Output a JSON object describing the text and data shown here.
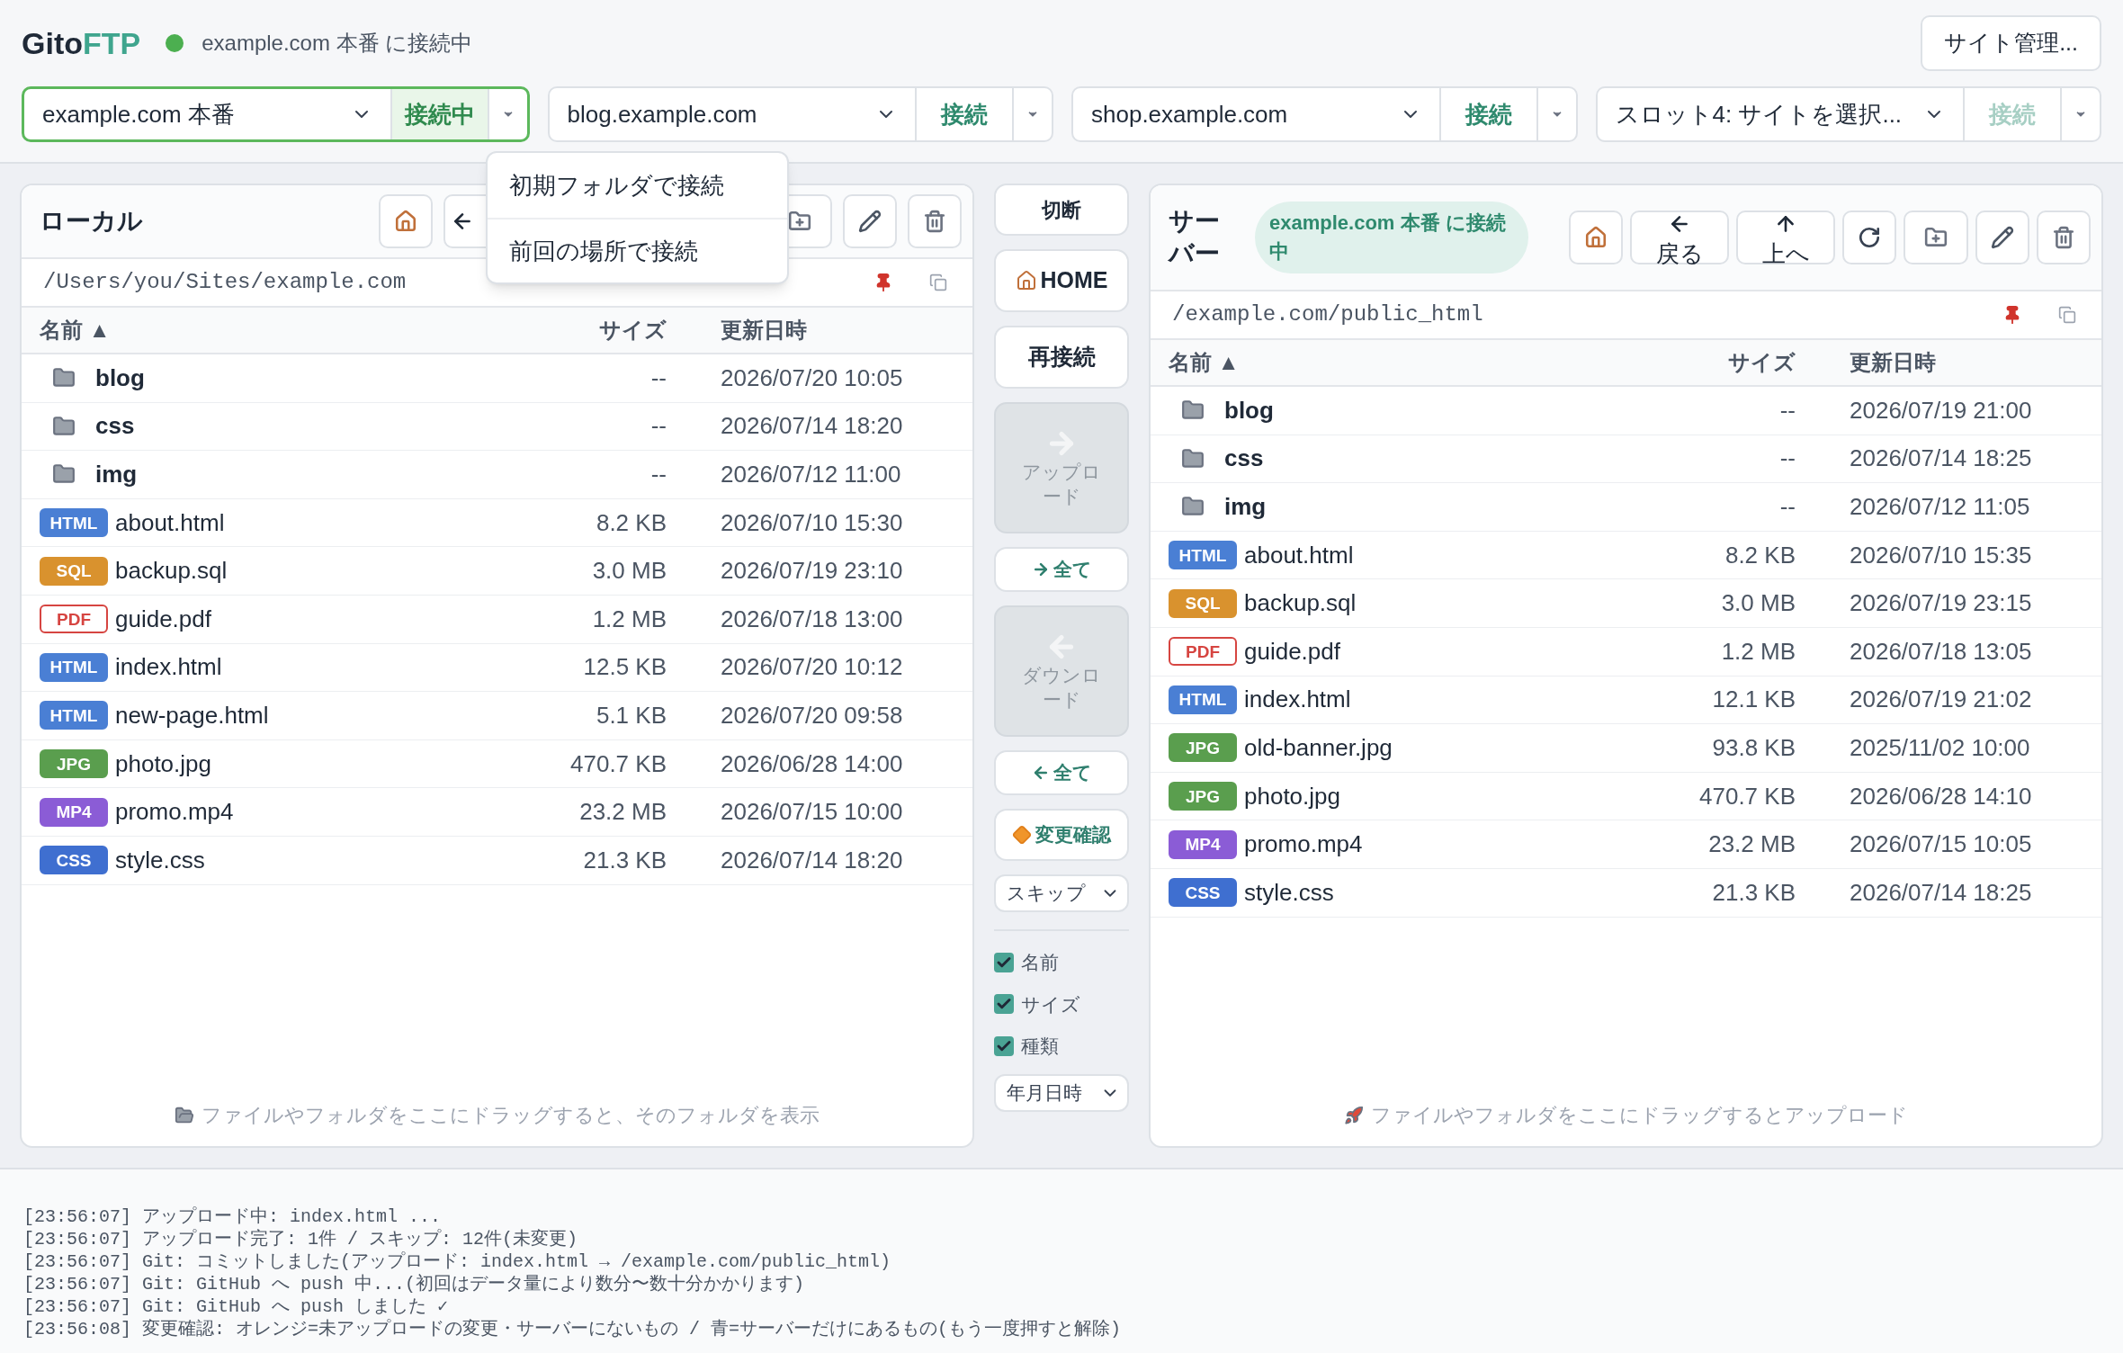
{
  "app": {
    "logo_main": "Gito",
    "logo_accent": "FTP",
    "status": {
      "connected": true,
      "text": "example.com 本番 に接続中"
    },
    "site_manager": "サイト管理..."
  },
  "slots": [
    {
      "site": "example.com 本番",
      "button": "接続中",
      "connected": true,
      "disabled": false
    },
    {
      "site": "blog.example.com",
      "button": "接続",
      "connected": false,
      "disabled": false
    },
    {
      "site": "shop.example.com",
      "button": "接続",
      "connected": false,
      "disabled": false
    },
    {
      "site": "スロット4: サイトを選択...",
      "button": "接続",
      "connected": false,
      "disabled": true
    }
  ],
  "connect_menu": {
    "open": true,
    "items": [
      "初期フォルダで接続",
      "前回の場所で接続"
    ]
  },
  "local": {
    "title": "ローカル",
    "toolbar": [
      {
        "kind": "home"
      },
      {
        "kind": "back"
      },
      {
        "kind": "new-folder"
      },
      {
        "kind": "rename"
      },
      {
        "kind": "delete"
      }
    ],
    "path": "/Users/you/Sites/example.com",
    "columns": [
      "名前 ▲",
      "サイズ",
      "更新日時"
    ],
    "rows": [
      {
        "kind": "folder",
        "name": "blog",
        "size": "--",
        "date": "2026/07/20 10:05"
      },
      {
        "kind": "folder",
        "name": "css",
        "size": "--",
        "date": "2026/07/14 18:20"
      },
      {
        "kind": "folder",
        "name": "img",
        "size": "--",
        "date": "2026/07/12 11:00"
      },
      {
        "kind": "file",
        "badge": "HTML",
        "color": "#4a7fd4",
        "name": "about.html",
        "size": "8.2 KB",
        "date": "2026/07/10 15:30"
      },
      {
        "kind": "file",
        "badge": "SQL",
        "color": "#d9922e",
        "name": "backup.sql",
        "size": "3.0 MB",
        "date": "2026/07/19 23:10"
      },
      {
        "kind": "outlined",
        "badge": "PDF",
        "color": "#d64541",
        "name": "guide.pdf",
        "size": "1.2 MB",
        "date": "2026/07/18 13:00"
      },
      {
        "kind": "file",
        "badge": "HTML",
        "color": "#4a7fd4",
        "name": "index.html",
        "size": "12.5 KB",
        "date": "2026/07/20 10:12"
      },
      {
        "kind": "file",
        "badge": "HTML",
        "color": "#4a7fd4",
        "name": "new-page.html",
        "size": "5.1 KB",
        "date": "2026/07/20 09:58"
      },
      {
        "kind": "file",
        "badge": "JPG",
        "color": "#5a9e4e",
        "name": "photo.jpg",
        "size": "470.7 KB",
        "date": "2026/06/28 14:00"
      },
      {
        "kind": "file",
        "badge": "MP4",
        "color": "#8b5cd6",
        "name": "promo.mp4",
        "size": "23.2 MB",
        "date": "2026/07/15 10:00"
      },
      {
        "kind": "file",
        "badge": "CSS",
        "color": "#3f6fd0",
        "name": "style.css",
        "size": "21.3 KB",
        "date": "2026/07/14 18:20"
      }
    ],
    "drop_hint": "ファイルやフォルダをここにドラッグすると、そのフォルダを表示"
  },
  "middle": [
    {
      "kind": "button",
      "label": "切断"
    },
    {
      "kind": "home",
      "label": "HOME"
    },
    {
      "kind": "big",
      "label": "再接続"
    },
    {
      "kind": "upload",
      "label": "アップロード",
      "disabled": true
    },
    {
      "kind": "upload-all",
      "label": "全て"
    },
    {
      "kind": "download",
      "label": "ダウンロード",
      "disabled": true
    },
    {
      "kind": "download-all",
      "label": "全て"
    },
    {
      "kind": "diff",
      "label": "変更確認"
    },
    {
      "kind": "select",
      "label": "スキップ"
    },
    {
      "kind": "divider"
    },
    {
      "kind": "check",
      "label": "名前",
      "checked": true
    },
    {
      "kind": "check",
      "label": "サイズ",
      "checked": true
    },
    {
      "kind": "check",
      "label": "種類",
      "checked": true
    },
    {
      "kind": "select",
      "label": "年月日時"
    }
  ],
  "server": {
    "title": "サーバー",
    "badge": "example.com 本番 に接続中",
    "toolbar": [
      {
        "kind": "home"
      },
      {
        "kind": "back",
        "label": "戻る"
      },
      {
        "kind": "up",
        "label": "上へ"
      },
      {
        "kind": "refresh"
      },
      {
        "kind": "new-folder"
      },
      {
        "kind": "rename"
      },
      {
        "kind": "delete"
      }
    ],
    "path": "/example.com/public_html",
    "columns": [
      "名前 ▲",
      "サイズ",
      "更新日時"
    ],
    "rows": [
      {
        "kind": "folder",
        "name": "blog",
        "size": "--",
        "date": "2026/07/19 21:00"
      },
      {
        "kind": "folder",
        "name": "css",
        "size": "--",
        "date": "2026/07/14 18:25"
      },
      {
        "kind": "folder",
        "name": "img",
        "size": "--",
        "date": "2026/07/12 11:05"
      },
      {
        "kind": "file",
        "badge": "HTML",
        "color": "#4a7fd4",
        "name": "about.html",
        "size": "8.2 KB",
        "date": "2026/07/10 15:35"
      },
      {
        "kind": "file",
        "badge": "SQL",
        "color": "#d9922e",
        "name": "backup.sql",
        "size": "3.0 MB",
        "date": "2026/07/19 23:15"
      },
      {
        "kind": "outlined",
        "badge": "PDF",
        "color": "#d64541",
        "name": "guide.pdf",
        "size": "1.2 MB",
        "date": "2026/07/18 13:05"
      },
      {
        "kind": "file",
        "badge": "HTML",
        "color": "#4a7fd4",
        "name": "index.html",
        "size": "12.1 KB",
        "date": "2026/07/19 21:02"
      },
      {
        "kind": "file",
        "badge": "JPG",
        "color": "#5a9e4e",
        "name": "old-banner.jpg",
        "size": "93.8 KB",
        "date": "2025/11/02 10:00"
      },
      {
        "kind": "file",
        "badge": "JPG",
        "color": "#5a9e4e",
        "name": "photo.jpg",
        "size": "470.7 KB",
        "date": "2026/06/28 14:10"
      },
      {
        "kind": "file",
        "badge": "MP4",
        "color": "#8b5cd6",
        "name": "promo.mp4",
        "size": "23.2 MB",
        "date": "2026/07/15 10:05"
      },
      {
        "kind": "file",
        "badge": "CSS",
        "color": "#3f6fd0",
        "name": "style.css",
        "size": "21.3 KB",
        "date": "2026/07/14 18:25"
      }
    ],
    "drop_hint": "ファイルやフォルダをここにドラッグするとアップロード"
  },
  "log": [
    "[23:56:07] アップロード中: index.html ...",
    "[23:56:07] アップロード完了: 1件 / スキップ: 12件(未変更)",
    "[23:56:07] Git: コミットしました(アップロード: index.html → /example.com/public_html)",
    "[23:56:07] Git: GitHub へ push 中...(初回はデータ量により数分〜数十分かかります)",
    "[23:56:07] Git: GitHub へ push しました ✓",
    "[23:56:08] 変更確認: オレンジ=未アップロードの変更・サーバーにないもの / 青=サーバーだけにあるもの(もう一度押すと解除)"
  ]
}
